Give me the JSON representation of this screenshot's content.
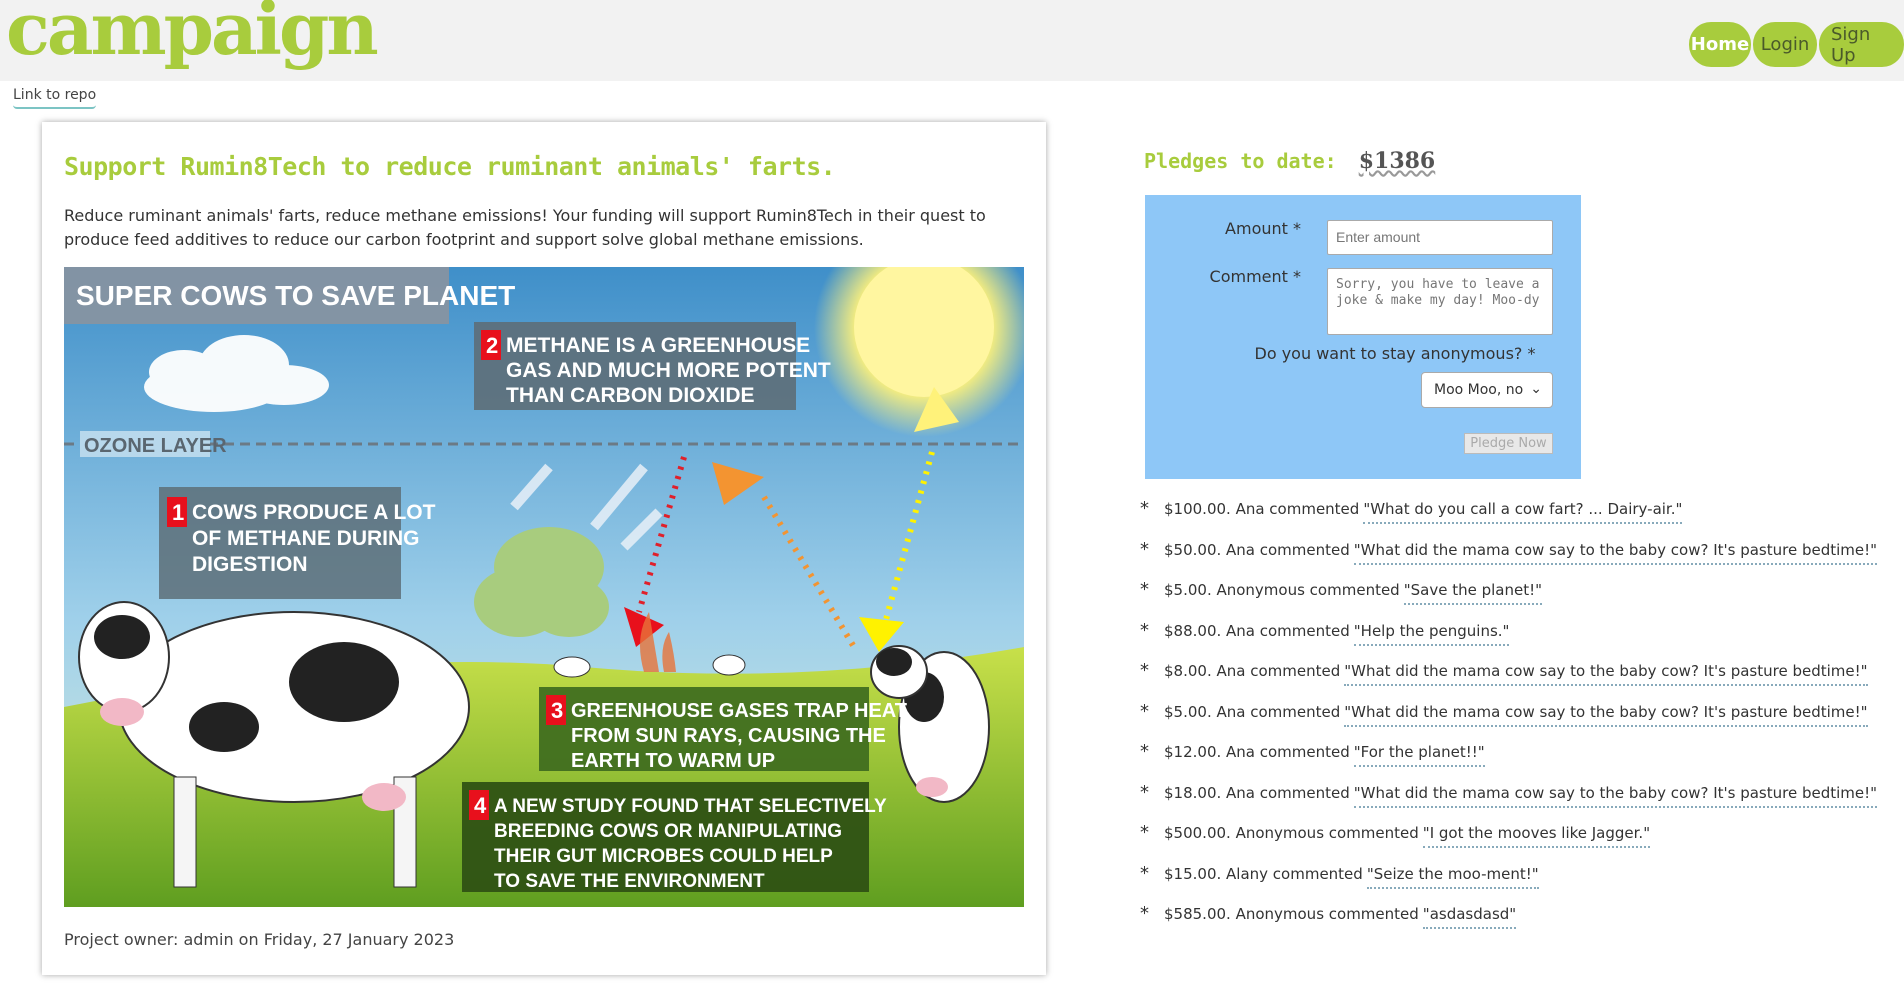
{
  "header": {
    "logo": "campaign",
    "nav": {
      "home": "Home",
      "login": "Login",
      "signup": "Sign Up"
    }
  },
  "repo_link": "Link to repo",
  "campaign": {
    "title": "Support Rumin8Tech to reduce ruminant animals' farts.",
    "description": "Reduce ruminant animals' farts, reduce methane emissions! Your funding will support Rumin8Tech in their quest to produce feed additives to reduce our carbon footprint and support solve global methane emissions.",
    "owner_line": "Project owner: admin on Friday, 27 January 2023",
    "image": {
      "headline": "SUPER COWS TO SAVE PLANET",
      "ozone": "OZONE LAYER",
      "steps": [
        {
          "num": "1",
          "text": [
            "COWS PRODUCE A LOT",
            "OF METHANE DURING",
            "DIGESTION"
          ]
        },
        {
          "num": "2",
          "text": [
            "METHANE IS A GREENHOUSE",
            "GAS AND MUCH MORE POTENT",
            "THAN CARBON DIOXIDE"
          ]
        },
        {
          "num": "3",
          "text": [
            "GREENHOUSE GASES TRAP HEAT",
            "FROM SUN RAYS, CAUSING THE",
            "EARTH TO WARM UP"
          ]
        },
        {
          "num": "4",
          "text": [
            "A NEW STUDY FOUND THAT SELECTIVELY",
            "BREEDING COWS OR MANIPULATING",
            "THEIR GUT MICROBES COULD HELP",
            "TO SAVE THE ENVIRONMENT"
          ]
        }
      ]
    }
  },
  "pledges": {
    "label": "Pledges to date:",
    "amount": "$1386"
  },
  "form": {
    "amount_label": "Amount *",
    "amount_placeholder": "Enter amount",
    "comment_label": "Comment *",
    "comment_value": "Sorry, you have to leave a joke & make my day! Moo-dy",
    "anonymous_label": "Do you want to stay anonymous? *",
    "anonymous_value": "Moo Moo, no",
    "submit": "Pledge Now"
  },
  "comments": [
    {
      "prefix": "$100.00. Ana commented",
      "quote": "\"What do you call a cow fart? ... Dairy-air.\""
    },
    {
      "prefix": "$50.00. Ana commented",
      "quote": "\"What did the mama cow say to the baby cow? It's pasture bedtime!\""
    },
    {
      "prefix": "$5.00. Anonymous commented",
      "quote": "\"Save the planet!\""
    },
    {
      "prefix": "$88.00. Ana commented",
      "quote": "\"Help the penguins.\""
    },
    {
      "prefix": "$8.00. Ana commented",
      "quote": "\"What did the mama cow say to the baby cow? It's pasture bedtime!\""
    },
    {
      "prefix": "$5.00. Ana commented",
      "quote": "\"What did the mama cow say to the baby cow? It's pasture bedtime!\""
    },
    {
      "prefix": "$12.00. Ana commented",
      "quote": "\"For the planet!!\""
    },
    {
      "prefix": "$18.00. Ana commented",
      "quote": "\"What did the mama cow say to the baby cow? It's pasture bedtime!\""
    },
    {
      "prefix": "$500.00. Anonymous commented",
      "quote": "\"I got the mooves like Jagger.\""
    },
    {
      "prefix": "$15.00. Alany commented",
      "quote": "\"Seize the moo-ment!\""
    },
    {
      "prefix": "$585.00. Anonymous commented",
      "quote": "\"asdasdasd\""
    }
  ],
  "colors": {
    "brand": "#a8cc3d",
    "form_bg": "#8ec7f7"
  }
}
